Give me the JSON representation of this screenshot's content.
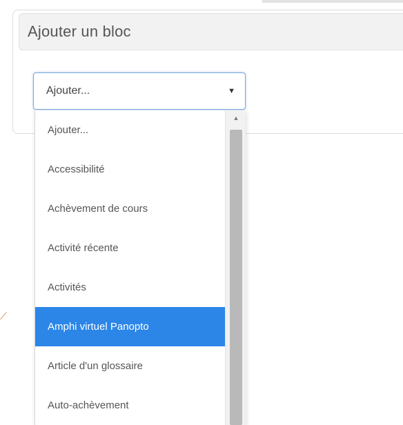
{
  "block_panel": {
    "title": "Ajouter un bloc"
  },
  "select": {
    "current_value": "Ajouter...",
    "arrow_icon": "dropdown-arrow-icon"
  },
  "dropdown": {
    "options": [
      {
        "label": "Ajouter...",
        "selected": false
      },
      {
        "label": "Accessibilité",
        "selected": false
      },
      {
        "label": "Achèvement de cours",
        "selected": false
      },
      {
        "label": "Activité récente",
        "selected": false
      },
      {
        "label": "Activités",
        "selected": false
      },
      {
        "label": "Amphi virtuel Panopto",
        "selected": true
      },
      {
        "label": "Article d'un glossaire",
        "selected": false
      },
      {
        "label": "Auto-achèvement",
        "selected": false
      }
    ],
    "highlight_color": "#2b86e8"
  }
}
